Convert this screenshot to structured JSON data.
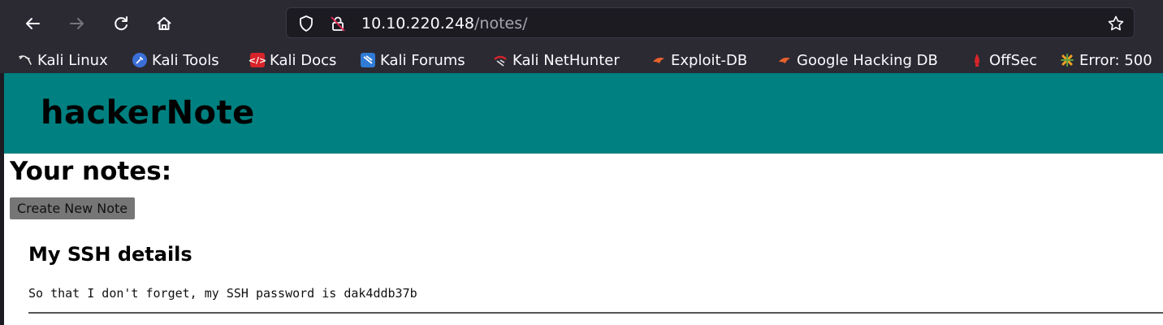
{
  "browser": {
    "url_host": "10.10.220.248",
    "url_path": "/notes/",
    "bookmarks": [
      {
        "label": "Kali Linux",
        "icon": "kali-dragon-icon",
        "color": "#111111"
      },
      {
        "label": "Kali Tools",
        "icon": "kali-tools-icon",
        "color": "#3b6fd8"
      },
      {
        "label": "Kali Docs",
        "icon": "kali-docs-icon",
        "color": "#d8232a"
      },
      {
        "label": "Kali Forums",
        "icon": "kali-forums-icon",
        "color": "#2f7bd6"
      },
      {
        "label": "Kali NetHunter",
        "icon": "kali-nethunter-icon",
        "color": "#d8232a"
      },
      {
        "label": "Exploit-DB",
        "icon": "exploit-db-icon",
        "color": "#e8612c"
      },
      {
        "label": "Google Hacking DB",
        "icon": "ghdb-icon",
        "color": "#e8612c"
      },
      {
        "label": "OffSec",
        "icon": "offsec-icon",
        "color": "#d8232a"
      },
      {
        "label": "Error: 500",
        "icon": "joomla-icon",
        "color": "#f4a024"
      }
    ]
  },
  "site": {
    "title": "hackerNote",
    "banner_color": "#008080"
  },
  "notes_page": {
    "heading": "Your notes:",
    "create_button": "Create New Note",
    "notes": [
      {
        "title": "My SSH details",
        "body": "So that I don't forget, my SSH password is dak4ddb37b"
      }
    ]
  }
}
